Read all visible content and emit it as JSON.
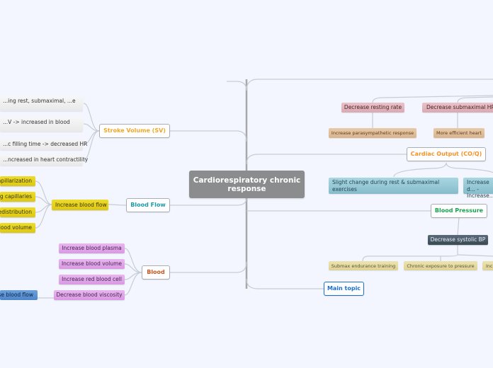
{
  "central": {
    "label": "Cardiorespiratory chronic response",
    "bg": "#8b8c8e"
  },
  "left": {
    "stroke_volume": {
      "label": "Stroke Volume (SV)",
      "color": "#f3a623",
      "children": [
        "...ing rest, submaximal, ...e",
        "...V -> increased in blood",
        "...c filling time -> decreased HR",
        "...ncreased in heart contractility"
      ]
    },
    "blood_flow": {
      "label": "Blood Flow",
      "color": "#1b9aa6",
      "child": "Increase blood flow",
      "grandchildren": [
        "...apillarization",
        "...g capillaries",
        "...edistribution",
        "...lood volume"
      ]
    },
    "blood": {
      "label": "Blood",
      "color": "#c8561e",
      "children": [
        "Increase blood plasma",
        "Increase blood volume",
        "Increase red blood cell",
        "Decrease blood viscosity"
      ],
      "grandchild": "...se blood flow"
    }
  },
  "right": {
    "heart_rate": {
      "children": [
        {
          "label": "Decrease resting rate",
          "sub": "Increase parasympathetic response"
        },
        {
          "label": "Decrease submaximal HR",
          "sub": "More efficient heart"
        }
      ]
    },
    "cardiac_output": {
      "label": "Cardiac Output (CO/Q)",
      "color": "#f3932b",
      "children": [
        "Slight change during rest & submaximal exercises",
        "Increase d... - Increase..."
      ]
    },
    "blood_pressure": {
      "label": "Blood Pressure",
      "color": "#1aa150",
      "child": "Decrease systolic BP",
      "grandchildren": [
        "Submax endurance training",
        "Chronic exposure to pressure",
        "Inc..."
      ]
    },
    "main_topic": {
      "label": "Main topic",
      "color": "#1a6fd0"
    }
  }
}
